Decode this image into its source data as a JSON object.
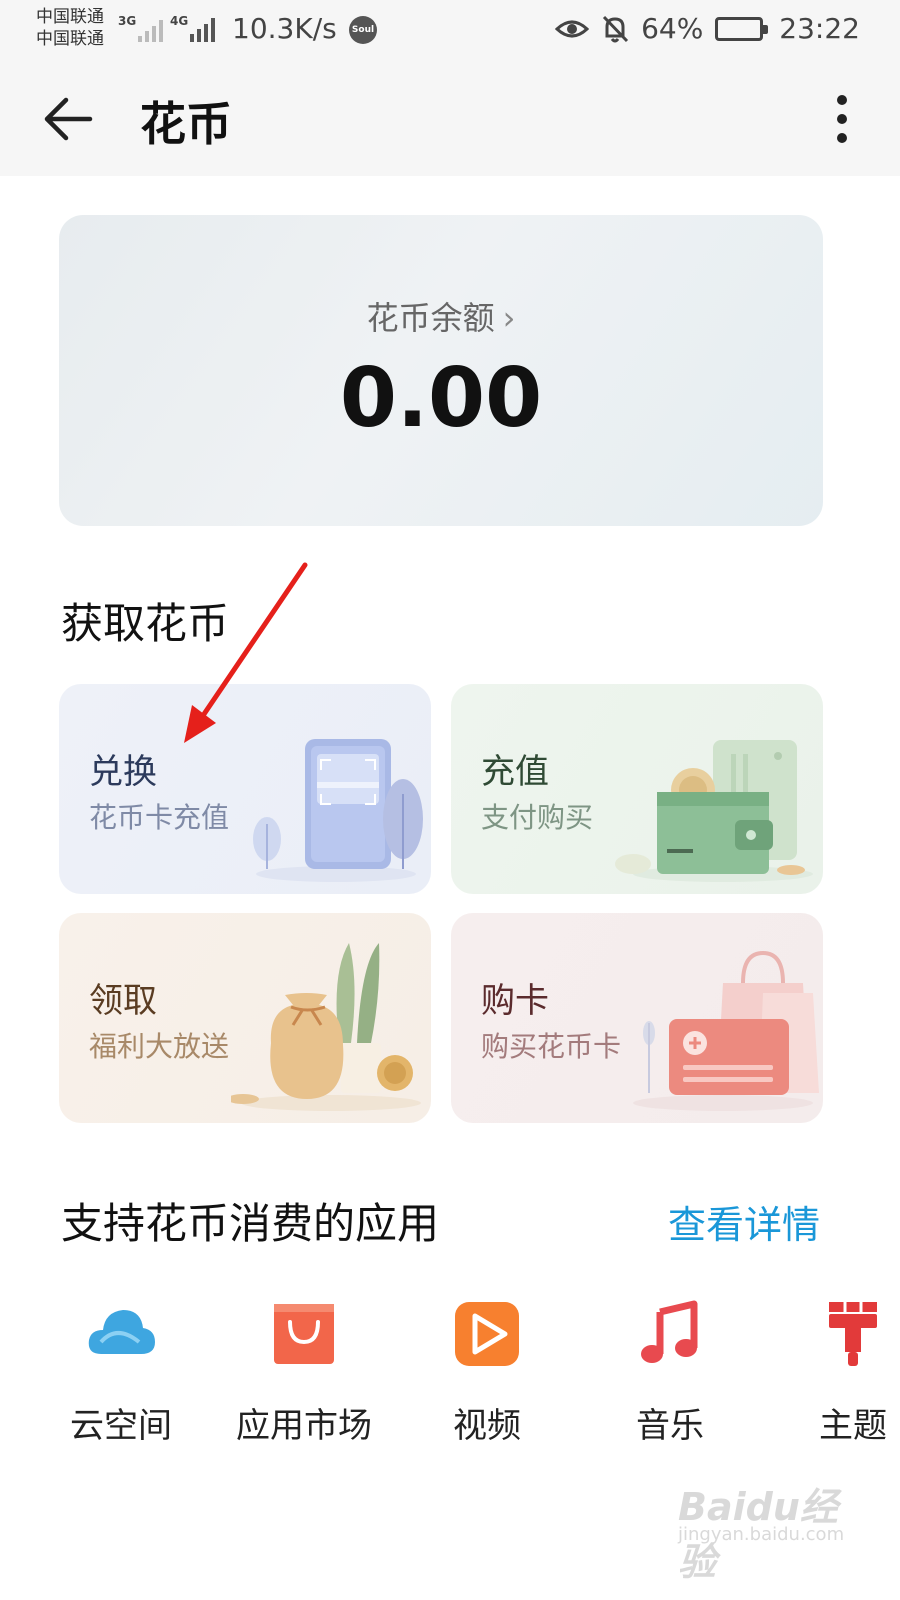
{
  "status_bar": {
    "carrier_1": "中国联通",
    "carrier_2": "中国联通",
    "net_1": "3G",
    "net_2": "4G",
    "speed": "10.3K/s",
    "soul_badge": "Soul",
    "battery": "64%",
    "time": "23:22"
  },
  "header": {
    "title": "花币"
  },
  "balance": {
    "label": "花币余额",
    "value": "0.00"
  },
  "earn_section": {
    "title": "获取花币",
    "cards": [
      {
        "title": "兑换",
        "subtitle": "花币卡充值"
      },
      {
        "title": "充值",
        "subtitle": "支付购买"
      },
      {
        "title": "领取",
        "subtitle": "福利大放送"
      },
      {
        "title": "购卡",
        "subtitle": "购买花币卡"
      }
    ]
  },
  "apps_section": {
    "title": "支持花币消费的应用",
    "details_link": "查看详情",
    "apps": [
      {
        "label": "云空间",
        "icon": "cloud-icon"
      },
      {
        "label": "应用市场",
        "icon": "shopping-bag-icon"
      },
      {
        "label": "视频",
        "icon": "play-icon"
      },
      {
        "label": "音乐",
        "icon": "music-note-icon"
      },
      {
        "label": "主题",
        "icon": "brush-icon"
      }
    ]
  },
  "watermark": {
    "brand": "Baidu经验",
    "url": "jingyan.baidu.com"
  },
  "colors": {
    "accent_link": "#1a97d8",
    "cloud": "#3ea6e0",
    "market": "#f2664a",
    "video": "#f7802f",
    "music": "#e84a4f",
    "theme": "#e23a3a",
    "annotation_arrow": "#e5201b"
  }
}
